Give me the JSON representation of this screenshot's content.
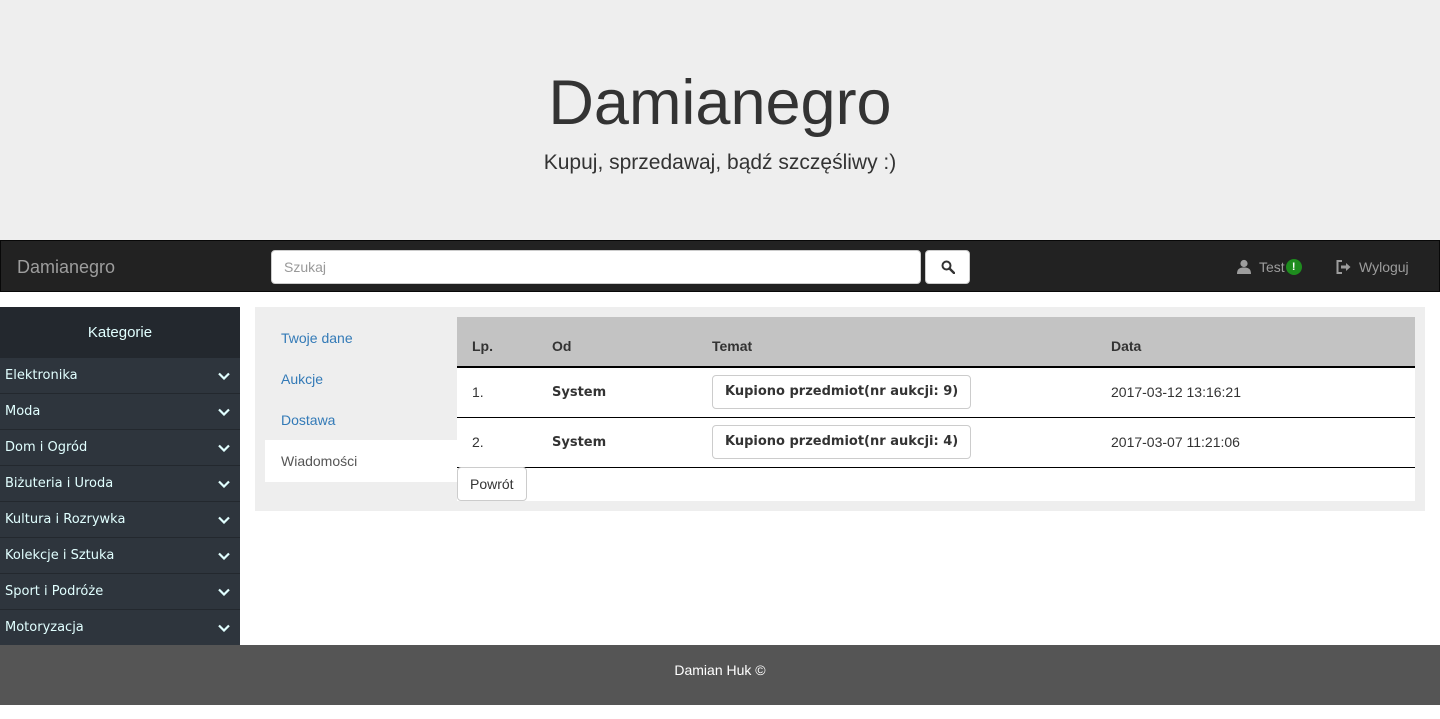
{
  "header": {
    "title": "Damianegro",
    "tagline": "Kupuj, sprzedawaj, bądź szczęśliwy :)"
  },
  "navbar": {
    "brand": "Damianegro",
    "search_placeholder": "Szukaj",
    "search_icon": "search-icon",
    "user_label": "Test",
    "user_badge": "!",
    "logout_label": "Wyloguj"
  },
  "sidebar": {
    "title": "Kategorie",
    "items": [
      {
        "label": "Elektronika"
      },
      {
        "label": "Moda"
      },
      {
        "label": "Dom i Ogród"
      },
      {
        "label": "Biżuteria i Uroda"
      },
      {
        "label": "Kultura i Rozrywka"
      },
      {
        "label": "Kolekcje i Sztuka"
      },
      {
        "label": "Sport i Podróże"
      },
      {
        "label": "Motoryzacja"
      }
    ]
  },
  "tabs": [
    {
      "label": "Twoje dane"
    },
    {
      "label": "Aukcje"
    },
    {
      "label": "Dostawa"
    },
    {
      "label": "Wiadomości",
      "active": true
    }
  ],
  "messages": {
    "columns": [
      "Lp.",
      "Od",
      "Temat",
      "Data"
    ],
    "rows": [
      {
        "no": "1.",
        "from": "System",
        "subject": "Kupiono przedmiot(nr aukcji: 9)",
        "date": "2017-03-12 13:16:21"
      },
      {
        "no": "2.",
        "from": "System",
        "subject": "Kupiono przedmiot(nr aukcji: 4)",
        "date": "2017-03-07 11:21:06"
      }
    ],
    "back_label": "Powrót"
  },
  "footer": {
    "text": "Damian Huk ©"
  },
  "colors": {
    "jumbotron_bg": "#eeeeee",
    "navbar_bg": "#222222",
    "sidebar_bg": "#2e353d",
    "link": "#337ab7",
    "badge": "#1e8c1e",
    "footer_bg": "#555555"
  }
}
